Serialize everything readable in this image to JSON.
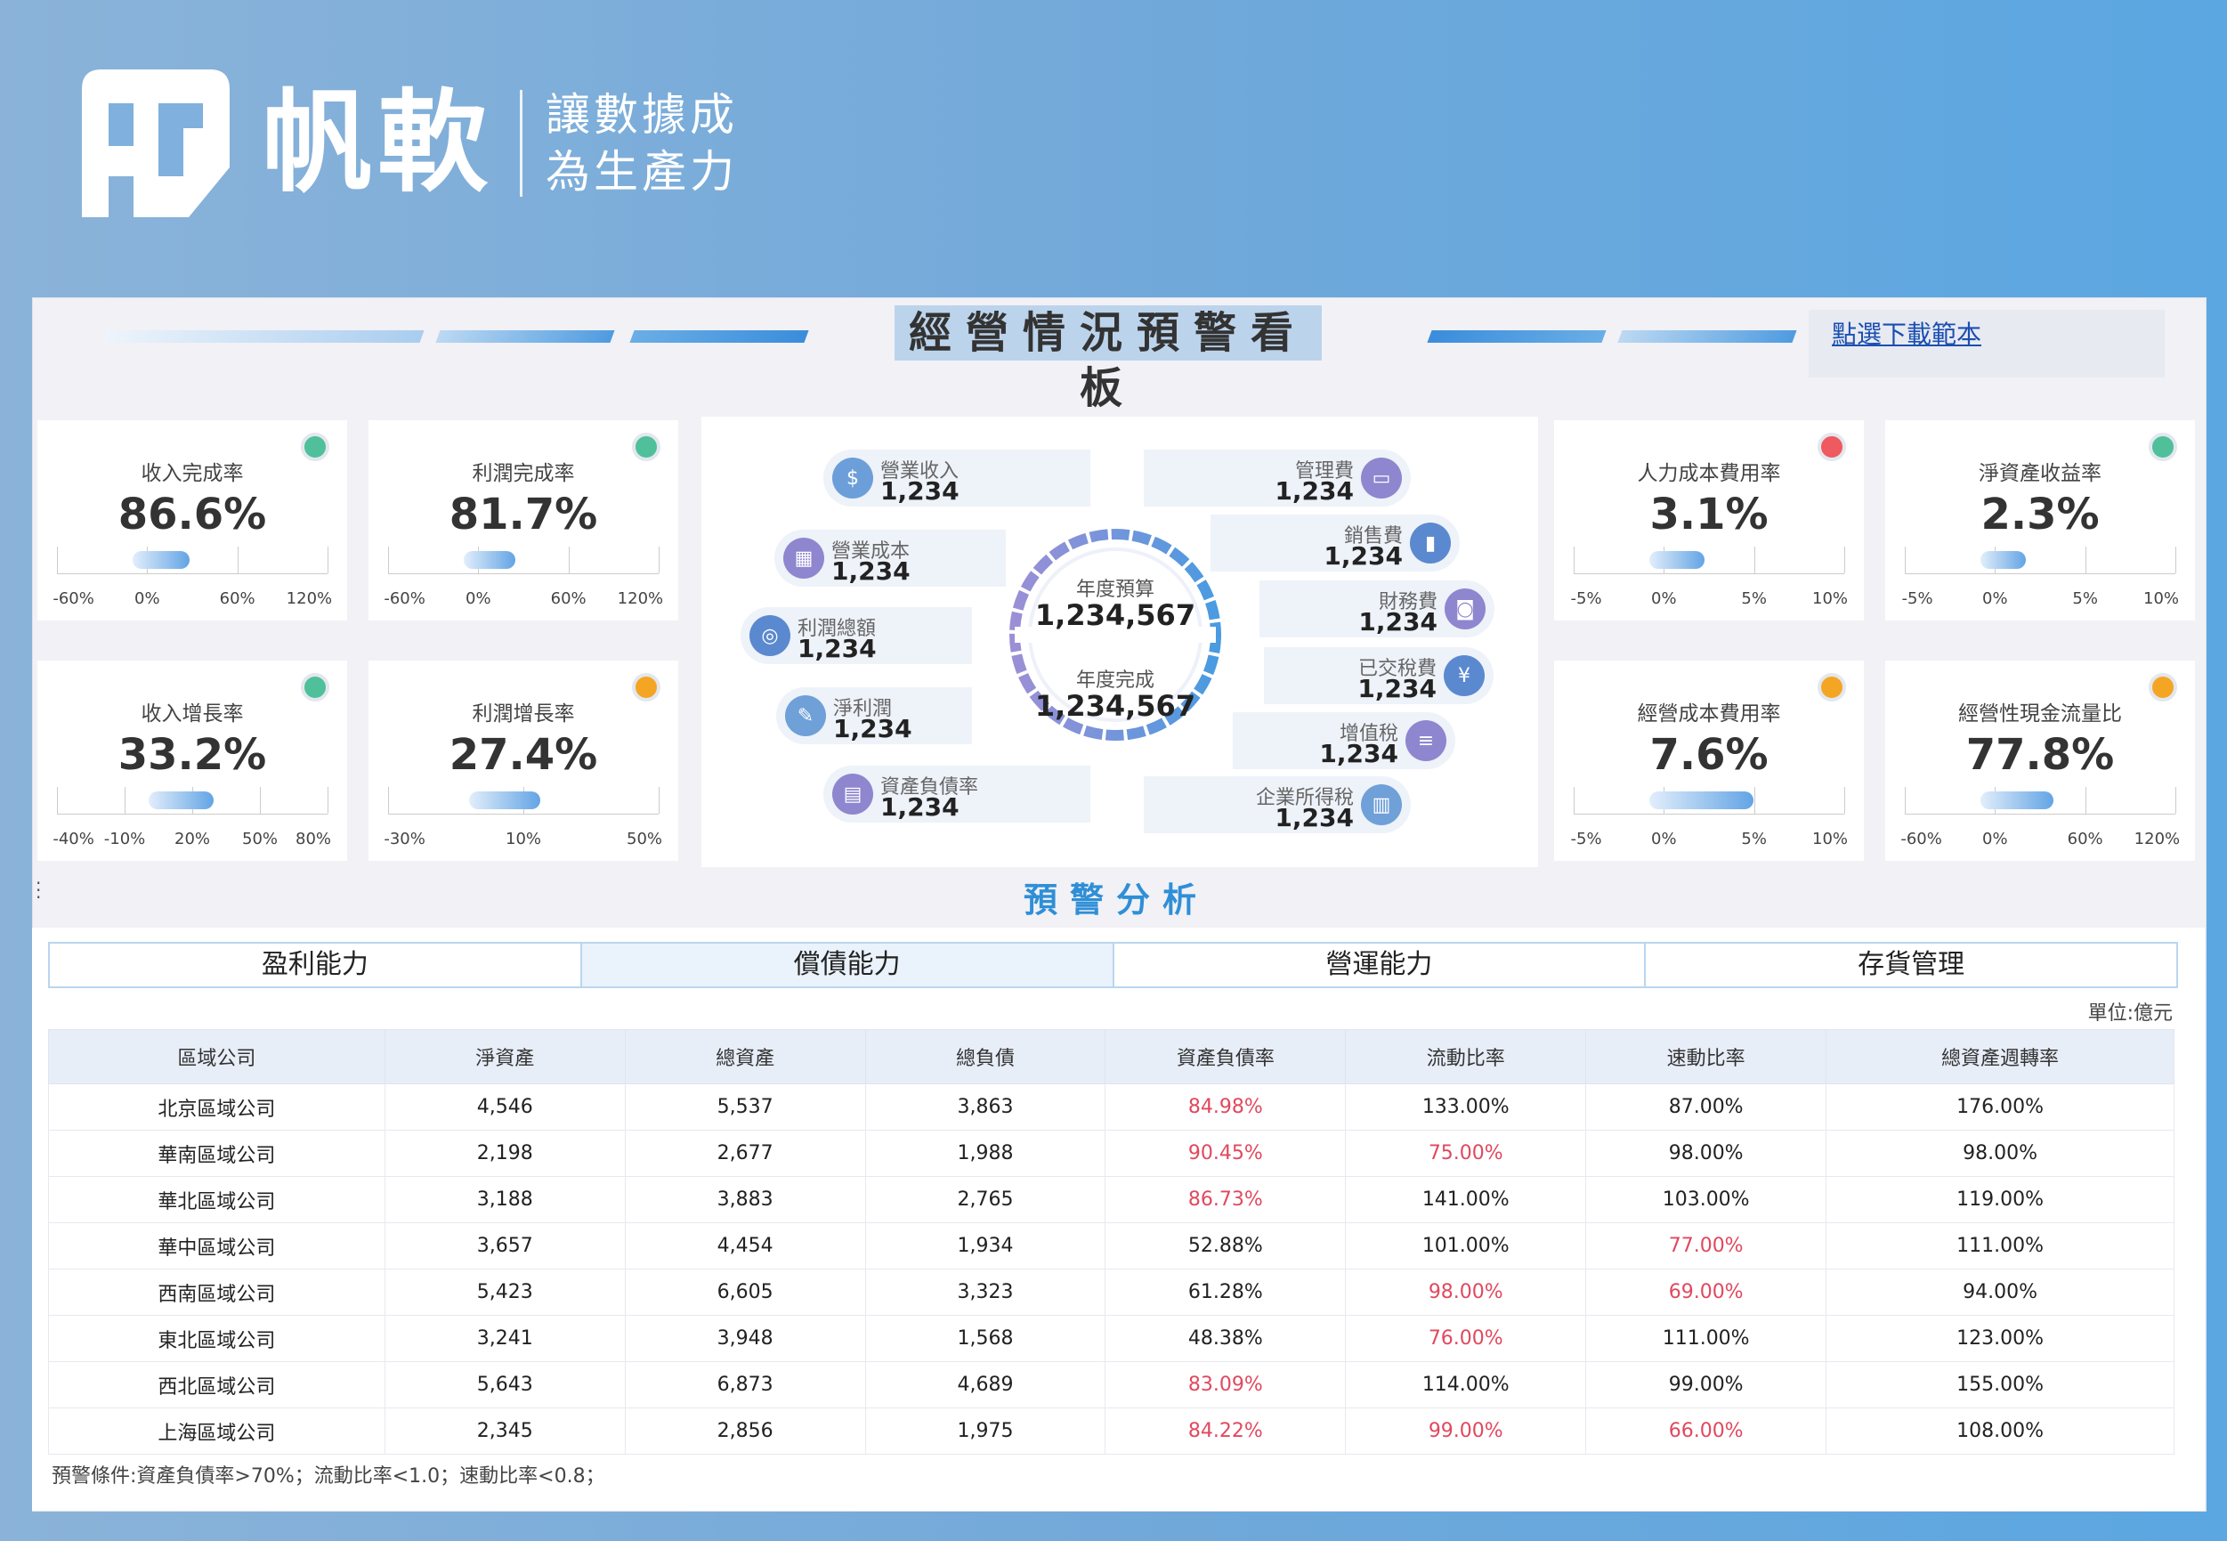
{
  "brand": {
    "name": "帆軟",
    "slogan_line1": "讓數據成",
    "slogan_line2": "為生產力",
    "logo_icon": "fanruan-logo-icon"
  },
  "header": {
    "title": "經營情況預警看板",
    "download_link": "點選下載範本"
  },
  "colors": {
    "green": "#4fc09a",
    "orange": "#f5a524",
    "red": "#ee5a60",
    "accent": "#2f8fd6",
    "alert_text": "#e0495e"
  },
  "kpis": [
    {
      "title": "收入完成率",
      "value": "86.6%",
      "status": "green",
      "ticks": [
        "-60%",
        "0%",
        "60%",
        "120%"
      ],
      "progress": 0.55
    },
    {
      "title": "利潤完成率",
      "value": "81.7%",
      "status": "green",
      "ticks": [
        "-60%",
        "0%",
        "60%",
        "120%"
      ],
      "progress": 0.52
    },
    {
      "title": "收入增長率",
      "value": "33.2%",
      "status": "green",
      "ticks": [
        "-40%",
        "-10%",
        "20%",
        "50%",
        "80%"
      ],
      "progress": 0.6
    },
    {
      "title": "利潤增長率",
      "value": "27.4%",
      "status": "orange",
      "ticks": [
        "-30%",
        "10%",
        "50%"
      ],
      "progress": 0.64
    },
    {
      "title": "人力成本費用率",
      "value": "3.1%",
      "status": "red",
      "ticks": [
        "-5%",
        "0%",
        "5%",
        "10%"
      ],
      "progress": 0.54
    },
    {
      "title": "淨資產收益率",
      "value": "2.3%",
      "status": "green",
      "ticks": [
        "-5%",
        "0%",
        "5%",
        "10%"
      ],
      "progress": 0.48
    },
    {
      "title": "經營成本費用率",
      "value": "7.6%",
      "status": "orange",
      "ticks": [
        "-5%",
        "0%",
        "5%",
        "10%"
      ],
      "progress": 0.84
    },
    {
      "title": "經營性現金流量比",
      "value": "77.8%",
      "status": "orange",
      "ticks": [
        "-60%",
        "0%",
        "60%",
        "120%"
      ],
      "progress": 0.65
    }
  ],
  "center": {
    "budget_label": "年度預算",
    "budget_value": "1,234,567",
    "done_label": "年度完成",
    "done_value": "1,234,567",
    "left": [
      {
        "label": "營業收入",
        "value": "1,234",
        "icon": "money-bag-icon"
      },
      {
        "label": "營業成本",
        "value": "1,234",
        "icon": "calculator-icon"
      },
      {
        "label": "利潤總額",
        "value": "1,234",
        "icon": "coins-icon"
      },
      {
        "label": "淨利潤",
        "value": "1,234",
        "icon": "report-icon"
      },
      {
        "label": "資產負債率",
        "value": "1,234",
        "icon": "document-icon"
      }
    ],
    "right": [
      {
        "label": "管理費",
        "value": "1,234",
        "icon": "card-icon"
      },
      {
        "label": "銷售費",
        "value": "1,234",
        "icon": "bar-chart-icon"
      },
      {
        "label": "財務費",
        "value": "1,234",
        "icon": "safe-icon"
      },
      {
        "label": "已交稅費",
        "value": "1,234",
        "icon": "tax-icon"
      },
      {
        "label": "增值稅",
        "value": "1,234",
        "icon": "coin-stack-icon"
      },
      {
        "label": "企業所得稅",
        "value": "1,234",
        "icon": "building-icon"
      }
    ]
  },
  "analysis": {
    "title": "預警分析",
    "tabs": [
      "盈利能力",
      "償債能力",
      "營運能力",
      "存貨管理"
    ],
    "active_tab": 1,
    "unit": "單位:億元",
    "columns": [
      "區域公司",
      "淨資產",
      "總資產",
      "總負債",
      "資產負債率",
      "流動比率",
      "速動比率",
      "總資產週轉率"
    ],
    "rows": [
      [
        "北京區域公司",
        "4,546",
        "5,537",
        "3,863",
        "84.98%",
        "133.00%",
        "87.00%",
        "176.00%"
      ],
      [
        "華南區域公司",
        "2,198",
        "2,677",
        "1,988",
        "90.45%",
        "75.00%",
        "98.00%",
        "98.00%"
      ],
      [
        "華北區域公司",
        "3,188",
        "3,883",
        "2,765",
        "86.73%",
        "141.00%",
        "103.00%",
        "119.00%"
      ],
      [
        "華中區域公司",
        "3,657",
        "4,454",
        "1,934",
        "52.88%",
        "101.00%",
        "77.00%",
        "111.00%"
      ],
      [
        "西南區域公司",
        "5,423",
        "6,605",
        "3,323",
        "61.28%",
        "98.00%",
        "69.00%",
        "94.00%"
      ],
      [
        "東北區域公司",
        "3,241",
        "3,948",
        "1,568",
        "48.38%",
        "76.00%",
        "111.00%",
        "123.00%"
      ],
      [
        "西北區域公司",
        "5,643",
        "6,873",
        "4,689",
        "83.09%",
        "114.00%",
        "99.00%",
        "155.00%"
      ],
      [
        "上海區域公司",
        "2,345",
        "2,856",
        "1,975",
        "84.22%",
        "99.00%",
        "66.00%",
        "108.00%"
      ]
    ],
    "alerts": [
      [
        4
      ],
      [
        4,
        5
      ],
      [
        4
      ],
      [
        6
      ],
      [
        5,
        6
      ],
      [
        5
      ],
      [
        4
      ],
      [
        4,
        5,
        6
      ]
    ],
    "note": "預警條件:資產負債率>70%；流動比率<1.0；速動比率<0.8；"
  }
}
